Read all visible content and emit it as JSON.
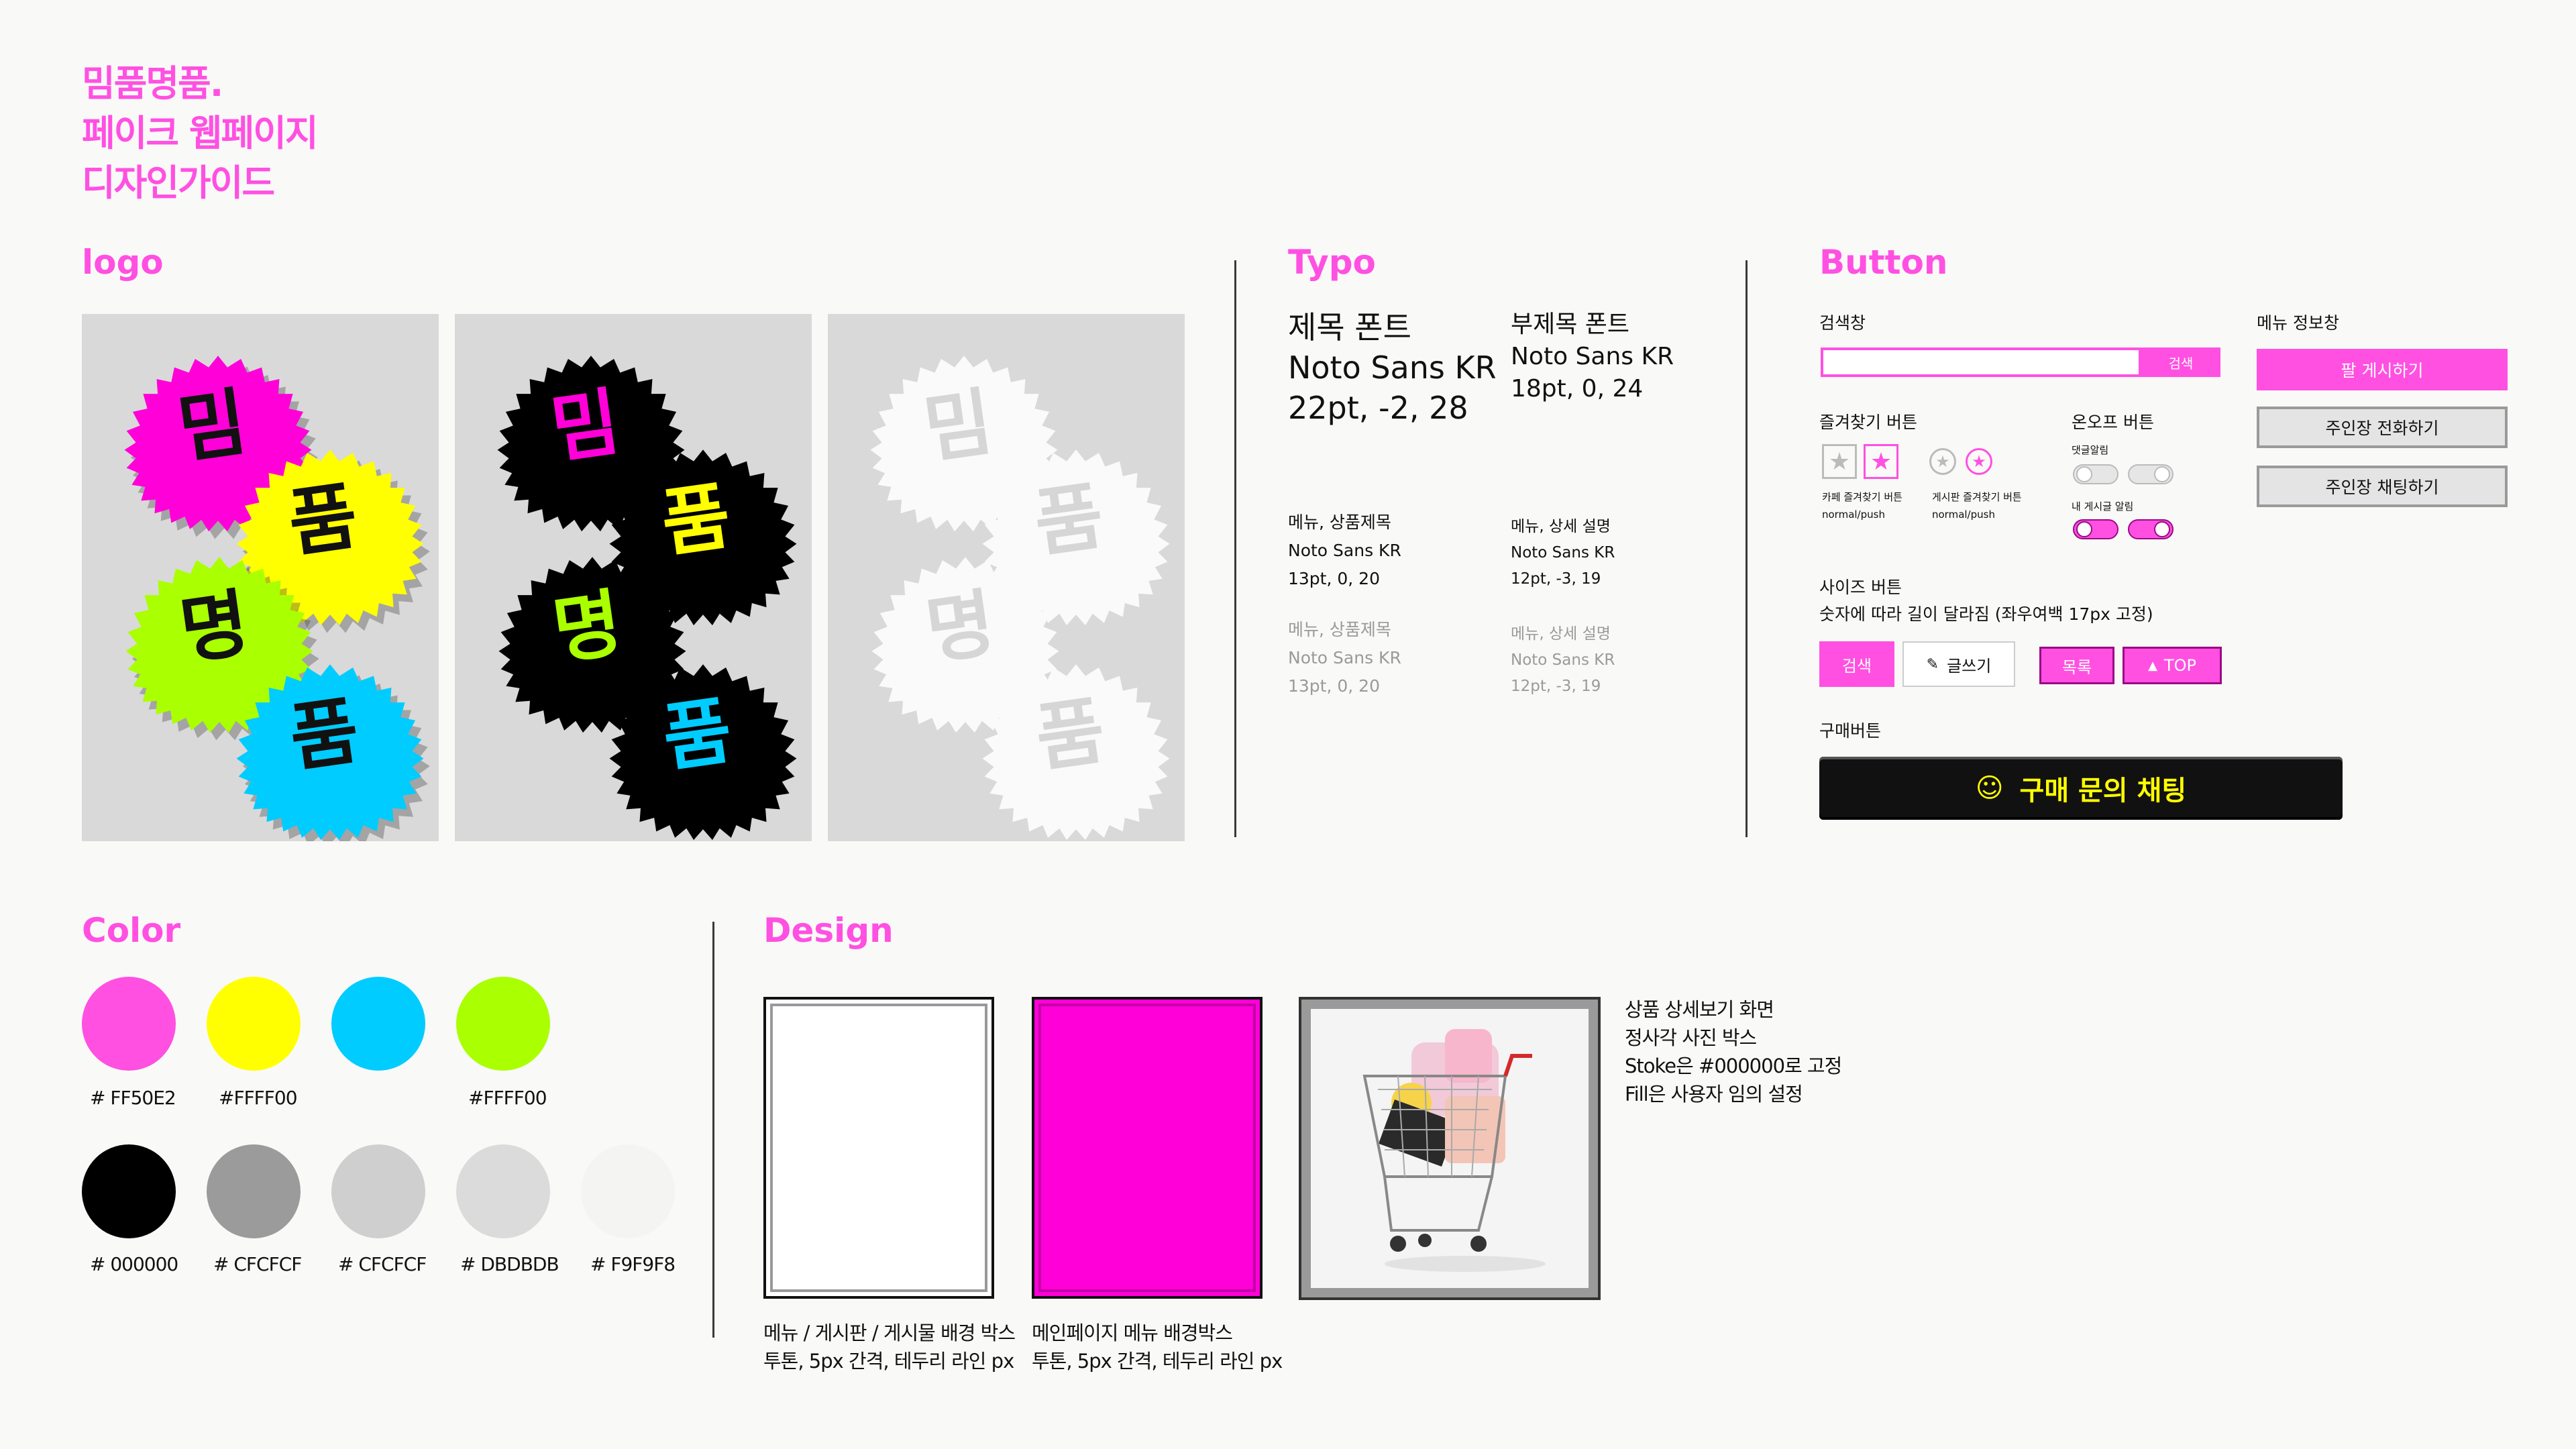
{
  "page_title": {
    "line1": "밈품명품.",
    "line2": "페이크 웹페이지",
    "line3": "디자인가이드"
  },
  "sections": {
    "logo": "logo",
    "typo": "Typo",
    "button": "Button",
    "color": "Color",
    "design": "Design"
  },
  "logo": {
    "chars": [
      "밈",
      "품",
      "명",
      "품"
    ]
  },
  "typo": {
    "title_font": {
      "label": "제목 폰트",
      "font": "Noto Sans KR",
      "spec": "22pt, -2, 28"
    },
    "subtitle_font": {
      "label": "부제목 폰트",
      "font": "Noto Sans KR",
      "spec": "18pt, 0, 24"
    },
    "menu_product": {
      "label": "메뉴, 상품제목",
      "font": "Noto Sans KR",
      "spec": "13pt, 0, 20"
    },
    "menu_detail": {
      "label": "메뉴, 상세 설명",
      "font": "Noto Sans KR",
      "spec": "12pt, -3, 19"
    },
    "menu_product_gray": {
      "label": "메뉴, 상품제목",
      "font": "Noto Sans KR",
      "spec": "13pt, 0, 20"
    },
    "menu_detail_gray": {
      "label": "메뉴, 상세 설명",
      "font": "Noto Sans KR",
      "spec": "12pt, -3, 19"
    }
  },
  "buttons": {
    "search_label": "검색창",
    "search_button": "검색",
    "favorite_label": "즐겨찾기 버튼",
    "favorite_cafe": {
      "line1": "카페 즐겨찾기 버튼",
      "line2": "normal/push"
    },
    "favorite_board": {
      "line1": "게시판 즐겨찾기 버튼",
      "line2": "normal/push"
    },
    "onoff_label": "온오프 버튼",
    "comment_alarm": "댓글알림",
    "post_alarm": "내 게시글 알림",
    "menu_info_label": "메뉴 정보창",
    "sell_post": "팔 게시하기",
    "call_owner": "주인장 전화하기",
    "chat_owner": "주인장 채팅하기",
    "size_label": "사이즈 버튼",
    "size_desc": "숫자에 따라 길이 달라짐 (좌우여백 17px 고정)",
    "size_search": "검색",
    "size_write": "글쓰기",
    "size_list": "목록",
    "size_top": "TOP",
    "buy_label": "구매버튼",
    "buy_button": "구매 문의 채팅"
  },
  "colors": {
    "row1": [
      {
        "hex": "#FF50E2",
        "label": "# FF50E2"
      },
      {
        "hex": "#FFFF00",
        "label": "#FFFF00"
      },
      {
        "hex": "#00CCFF",
        "label": ""
      },
      {
        "hex": "#AAFF00",
        "label": "#FFFF00"
      }
    ],
    "row2": [
      {
        "hex": "#000000",
        "label": "# 000000"
      },
      {
        "hex": "#9B9B9B",
        "label": "# CFCFCF"
      },
      {
        "hex": "#CFCFCF",
        "label": "# CFCFCF"
      },
      {
        "hex": "#DBDBDB",
        "label": "# DBDBDB"
      },
      {
        "hex": "#F9F9F8",
        "label": "# F9F9F8"
      }
    ]
  },
  "design": {
    "white_box": {
      "line1": "메뉴 / 게시판 / 게시물 배경 박스",
      "line2": "투톤, 5px 간격, 테두리 라인 px"
    },
    "pink_box": {
      "line1": "메인페이지 메뉴 배경박스",
      "line2": "투톤, 5px 간격, 테두리 라인 px"
    },
    "photo_box": {
      "line1": "상품 상세보기 화면",
      "line2": "정사각 사진 박스",
      "line3": "Stoke은 #000000로 고정",
      "line4": "Fill은 사용자 임의 설정"
    }
  }
}
